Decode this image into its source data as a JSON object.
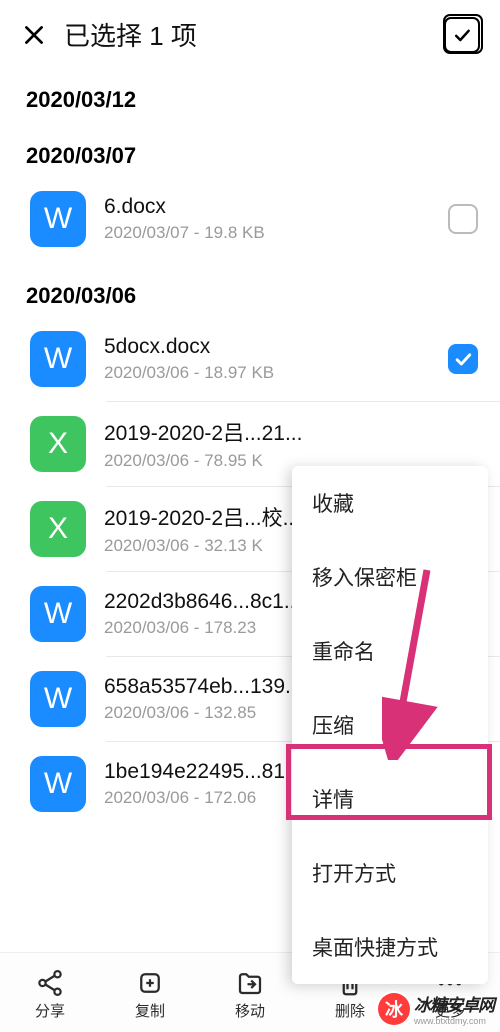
{
  "header": {
    "title": "已选择 1 项"
  },
  "dates": {
    "d1": "2020/03/12",
    "d2": "2020/03/07",
    "d3": "2020/03/06"
  },
  "files": {
    "f1": {
      "name": "6.docx",
      "meta": "2020/03/07 - 19.8 KB",
      "letter": "W"
    },
    "f2": {
      "name": "5docx.docx",
      "meta": "2020/03/06 - 18.97 KB",
      "letter": "W"
    },
    "f3": {
      "name": "2019-2020-2吕...21...",
      "meta": "2020/03/06 - 78.95 K",
      "letter": "X"
    },
    "f4": {
      "name": "2019-2020-2吕...校...",
      "meta": "2020/03/06 - 32.13 K",
      "letter": "X"
    },
    "f5": {
      "name": "2202d3b8646...8c1...",
      "meta": "2020/03/06 - 178.23",
      "letter": "W"
    },
    "f6": {
      "name": "658a53574eb...139...",
      "meta": "2020/03/06 - 132.85",
      "letter": "W"
    },
    "f7": {
      "name": "1be194e22495...81...",
      "meta": "2020/03/06 - 172.06",
      "letter": "W"
    }
  },
  "popup": {
    "favorite": "收藏",
    "vault": "移入保密柜",
    "rename": "重命名",
    "compress": "压缩",
    "details": "详情",
    "openwith": "打开方式",
    "shortcut": "桌面快捷方式"
  },
  "bottom": {
    "share": "分享",
    "copy": "复制",
    "move": "移动",
    "delete": "删除",
    "more": "更多"
  },
  "watermark": {
    "badge": "冰",
    "text": "冰糖安卓网",
    "url": "www.btxtdmy.com"
  }
}
